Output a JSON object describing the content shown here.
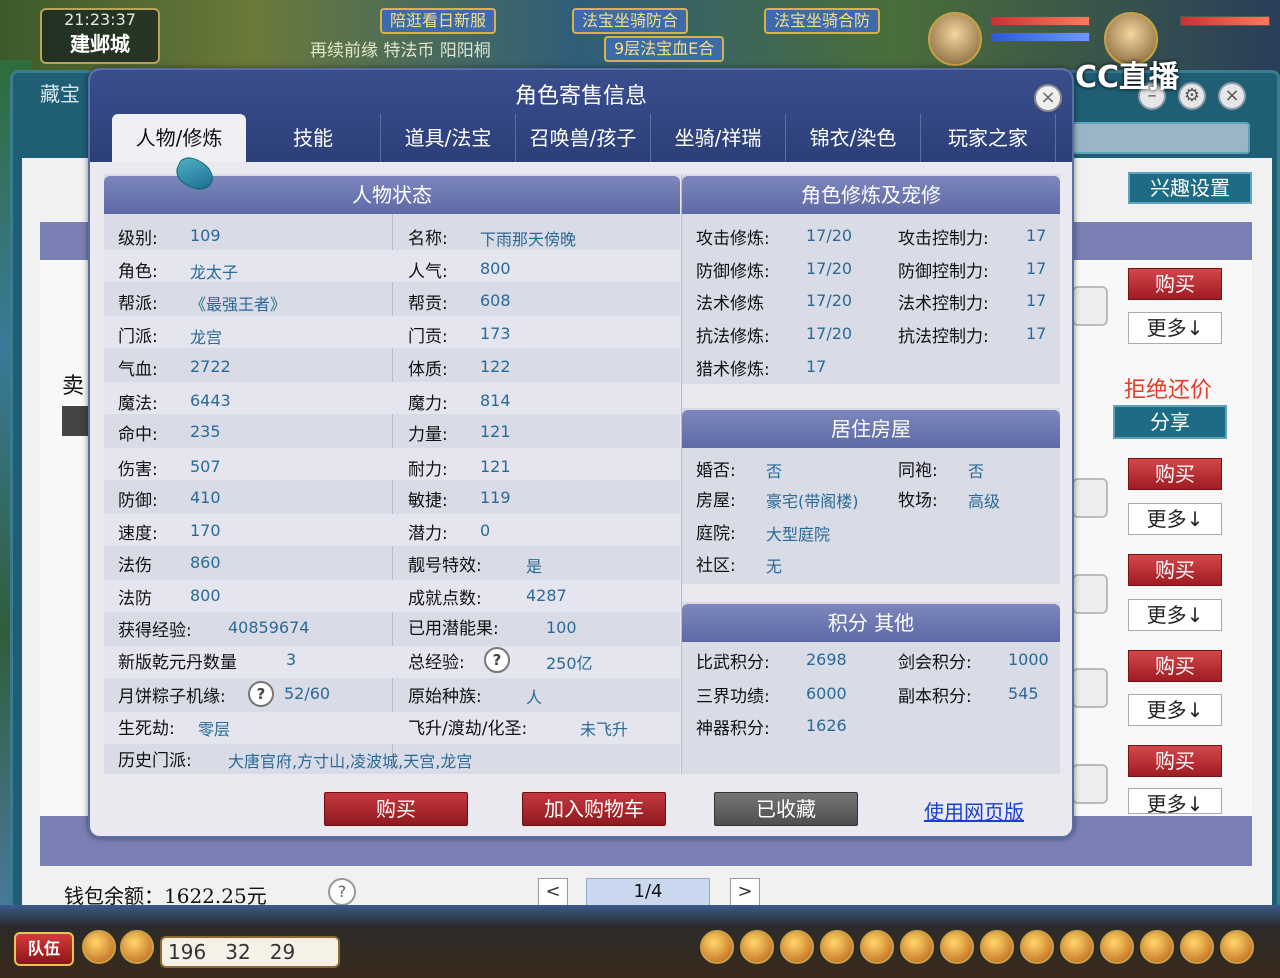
{
  "game": {
    "time": "21:23:37",
    "city": "建邺城",
    "banners": [
      "陪逛看日新服",
      "法宝坐骑防合",
      "法宝坐骑合防",
      "9层法宝血E合"
    ],
    "scroll_text": "再续前缘 特法币 阳阳桐",
    "stream_logo": "CC直播",
    "coords": "196   32   29",
    "team_label": "队伍"
  },
  "store": {
    "title": "藏宝",
    "interest_label": "兴趣设置",
    "left_label": "卖",
    "buy_label": "购买",
    "more_label": "更多↓",
    "refuse_label": "拒绝还价",
    "share_label": "分享",
    "wallet": "钱包余额：1622.25元",
    "help": "?",
    "page_prev": "<",
    "page_next": ">",
    "page": "1/4"
  },
  "modal": {
    "title": "角色寄售信息",
    "close": "×",
    "tabs": [
      "人物/修炼",
      "技能",
      "道具/法宝",
      "召唤兽/孩子",
      "坐骑/祥瑞",
      "锦衣/染色",
      "玩家之家"
    ],
    "status_header": "人物状态",
    "left_col": [
      {
        "label": "级别:",
        "value": "109"
      },
      {
        "label": "角色:",
        "value": "龙太子"
      },
      {
        "label": "帮派:",
        "value": "《最强王者》"
      },
      {
        "label": "门派:",
        "value": "龙宫"
      },
      {
        "label": "气血:",
        "value": "2722"
      },
      {
        "label": "魔法:",
        "value": "6443"
      },
      {
        "label": "命中:",
        "value": "235"
      },
      {
        "label": "伤害:",
        "value": "507"
      },
      {
        "label": "防御:",
        "value": "410"
      },
      {
        "label": "速度:",
        "value": "170"
      },
      {
        "label": "法伤",
        "value": "860"
      },
      {
        "label": "法防",
        "value": "800"
      }
    ],
    "mid_col": [
      {
        "label": "名称:",
        "value": "下雨那天傍晚"
      },
      {
        "label": "人气:",
        "value": "800"
      },
      {
        "label": "帮贡:",
        "value": "608"
      },
      {
        "label": "门贡:",
        "value": "173"
      },
      {
        "label": "体质:",
        "value": "122"
      },
      {
        "label": "魔力:",
        "value": "814"
      },
      {
        "label": "力量:",
        "value": "121"
      },
      {
        "label": "耐力:",
        "value": "121"
      },
      {
        "label": "敏捷:",
        "value": "119"
      },
      {
        "label": "潜力:",
        "value": "0"
      },
      {
        "label": "靓号特效:",
        "value": "是"
      },
      {
        "label": "成就点数:",
        "value": "4287"
      }
    ],
    "extra_rows": {
      "exp_label": "获得经验:",
      "exp_value": "40859674",
      "used_label": "已用潜能果:",
      "used_value": "100",
      "qian_label": "新版乾元丹数量",
      "qian_value": "3",
      "total_label": "总经验:",
      "total_value": "250亿",
      "moon_label": "月饼粽子机缘:",
      "moon_value": "52/60",
      "race_label": "原始种族:",
      "race_value": "人",
      "death_label": "生死劫:",
      "death_value": "零层",
      "fly_label": "飞升/渡劫/化圣:",
      "fly_value": "未飞升",
      "history_label": "历史门派:",
      "history_value": "大唐官府,方寸山,凌波城,天宫,龙宫",
      "q": "?"
    },
    "cultivation_header": "角色修炼及宠修",
    "cultivation": [
      {
        "l1": "攻击修炼:",
        "v1": "17/20",
        "l2": "攻击控制力:",
        "v2": "17"
      },
      {
        "l1": "防御修炼:",
        "v1": "17/20",
        "l2": "防御控制力:",
        "v2": "17"
      },
      {
        "l1": "法术修炼",
        "v1": "17/20",
        "l2": "法术控制力:",
        "v2": "17"
      },
      {
        "l1": "抗法修炼:",
        "v1": "17/20",
        "l2": "抗法控制力:",
        "v2": "17"
      },
      {
        "l1": "猎术修炼:",
        "v1": "17",
        "l2": "",
        "v2": ""
      }
    ],
    "house_header": "居住房屋",
    "house": [
      {
        "l1": "婚否:",
        "v1": "否",
        "l2": "同袍:",
        "v2": "否"
      },
      {
        "l1": "房屋:",
        "v1": "豪宅(带阁楼)",
        "l2": "牧场:",
        "v2": "高级"
      },
      {
        "l1": "庭院:",
        "v1": "大型庭院",
        "l2": "",
        "v2": ""
      },
      {
        "l1": "社区:",
        "v1": "无",
        "l2": "",
        "v2": ""
      }
    ],
    "score_header": "积分 其他",
    "scores": [
      {
        "l1": "比武积分:",
        "v1": "2698",
        "l2": "剑会积分:",
        "v2": "1000"
      },
      {
        "l1": "三界功绩:",
        "v1": "6000",
        "l2": "副本积分:",
        "v2": "545"
      },
      {
        "l1": "神器积分:",
        "v1": "1626",
        "l2": "",
        "v2": ""
      }
    ],
    "buttons": {
      "buy": "购买",
      "cart": "加入购物车",
      "fav": "已收藏",
      "web": "使用网页版"
    }
  }
}
